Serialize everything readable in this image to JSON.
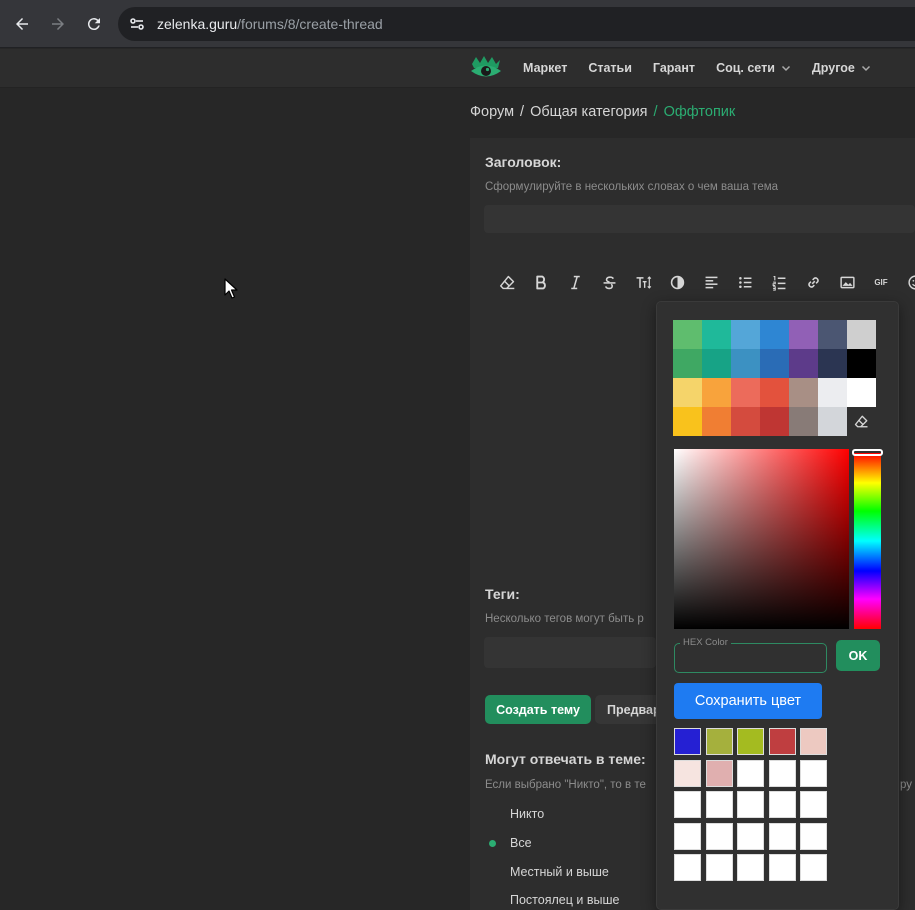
{
  "browser": {
    "url_host": "zelenka.guru",
    "url_path": "/forums/8/create-thread"
  },
  "nav": {
    "items": [
      {
        "label": "Маркет",
        "dropdown": false
      },
      {
        "label": "Статьи",
        "dropdown": false
      },
      {
        "label": "Гарант",
        "dropdown": false
      },
      {
        "label": "Соц. сети",
        "dropdown": true
      },
      {
        "label": "Другое",
        "dropdown": true
      }
    ]
  },
  "breadcrumb": {
    "forum": "Форум",
    "category": "Общая категория",
    "current": "Оффтопик",
    "separator": "/"
  },
  "form": {
    "title_label": "Заголовок:",
    "title_hint": "Сформулируйте в нескольких словах о чем ваша тема",
    "tags_label": "Теги:",
    "tags_hint": "Несколько тегов могут быть р",
    "create_button": "Создать тему",
    "preview_button": "Предвар",
    "reply_label": "Могут отвечать в теме:",
    "reply_hint": "Если выбрано \"Никто\", то в те",
    "reply_hint_tail": "ру",
    "reply_options": [
      {
        "label": "Никто",
        "selected": false
      },
      {
        "label": "Все",
        "selected": true
      },
      {
        "label": "Местный и выше",
        "selected": false
      },
      {
        "label": "Постоялец и выше",
        "selected": false
      }
    ]
  },
  "toolbar": {
    "gif_label": "GIF",
    "buttons": [
      "eraser-icon",
      "bold-icon",
      "italic-icon",
      "strikethrough-icon",
      "font-size-icon",
      "text-color-icon",
      "align-icon",
      "bullet-list-icon",
      "numbered-list-icon",
      "link-icon",
      "image-icon",
      "gif-icon",
      "emoji-icon"
    ]
  },
  "color_picker": {
    "palette": [
      "#5fbd6e",
      "#1fb99a",
      "#54a6d8",
      "#2e86d3",
      "#9160b6",
      "#4b5672",
      "#cfcfcf",
      "#3fa863",
      "#17a386",
      "#3c91c2",
      "#2a6cb6",
      "#5d3b8a",
      "#2b3552",
      "#000000",
      "#f5d46a",
      "#f8a33c",
      "#ec6b5b",
      "#e3523d",
      "#a88f85",
      "#ecedf0",
      "#ffffff",
      "#f9c21c",
      "#f07e33",
      "#d44b3e",
      "#bf3633",
      "#887b77",
      "#d3d6da",
      "eraser"
    ],
    "hex_label": "HEX Color",
    "hex_value": "",
    "ok_label": "OK",
    "save_label": "Сохранить цвет",
    "saved_colors": [
      "#2520d3",
      "#a5b03d",
      "#a4bb20",
      "#bf3e40",
      "#edc9c1",
      "#f6e4e0",
      "#e0afaf",
      "#ffffff",
      "#ffffff",
      "#ffffff",
      "#ffffff",
      "#ffffff",
      "#ffffff",
      "#ffffff",
      "#ffffff",
      "#ffffff",
      "#ffffff",
      "#ffffff",
      "#ffffff",
      "#ffffff",
      "#ffffff",
      "#ffffff",
      "#ffffff",
      "#ffffff",
      "#ffffff"
    ],
    "hue_value": 0
  },
  "colors": {
    "accent_green": "#2bad72",
    "button_green": "#228e5d",
    "save_blue": "#1e7bf2"
  }
}
